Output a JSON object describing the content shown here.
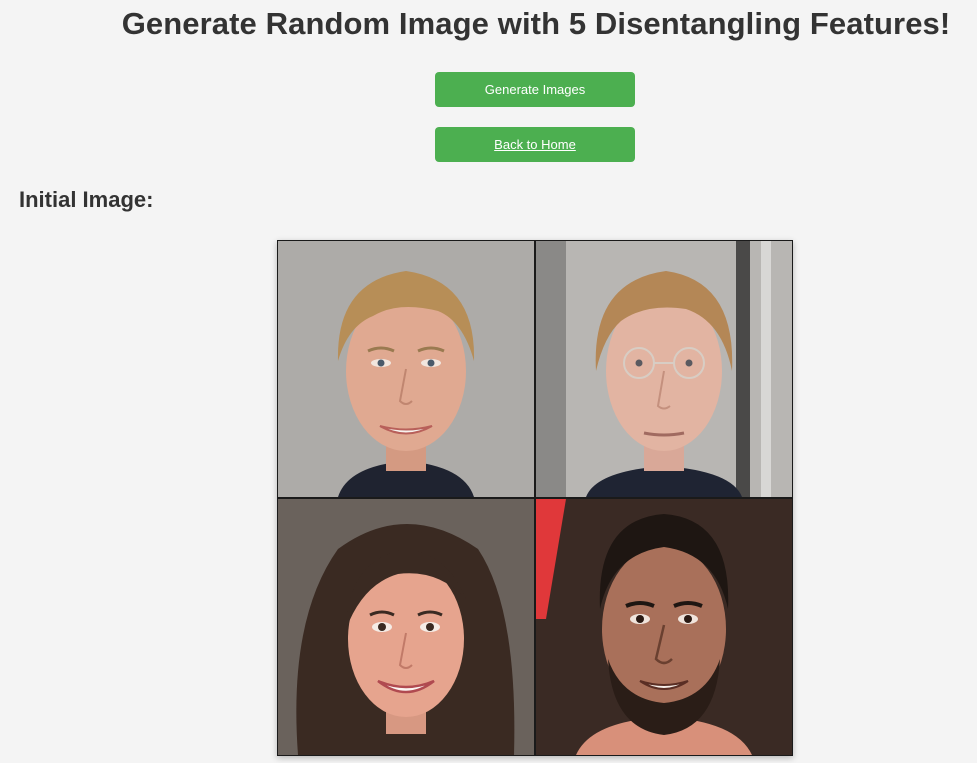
{
  "header": {
    "title": "Generate Random Image with 5 Disentangling Features!"
  },
  "actions": {
    "generate_label": "Generate Images",
    "home_label": "Back to Home"
  },
  "section": {
    "initial_label": "Initial Image:"
  },
  "colors": {
    "button": "#4caf50",
    "background": "#f4f4f4",
    "text": "#333333"
  }
}
